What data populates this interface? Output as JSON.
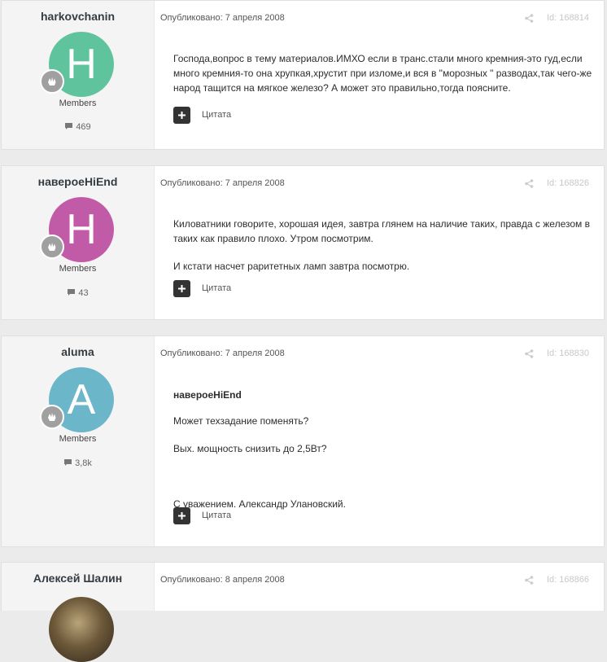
{
  "posts": [
    {
      "author": "harkovchanin",
      "avatar_letter": "H",
      "avatar_color": "#5fc49d",
      "group": "Members",
      "post_count": "469",
      "published": "Опубликовано: 7 апреля 2008",
      "post_id": "Id: 168814",
      "quote_author": "",
      "paragraphs": [
        "Господа,вопрос в тему материалов.ИМХО если в транс.стали много кремния-это гуд,если много кремния-то она хрупкая,хрустит при изломе,и вся в \"морозных \" разводах,так чего-же народ тащится на мягкое железо? А может это правильно,тогда поясните."
      ],
      "quote_label": "Цитата"
    },
    {
      "author": "навероеHiEnd",
      "avatar_letter": "H",
      "avatar_color": "#c15ba7",
      "group": "Members",
      "post_count": "43",
      "published": "Опубликовано: 7 апреля 2008",
      "post_id": "Id: 168826",
      "quote_author": "",
      "paragraphs": [
        "Киловатники говорите, хорошая идея, завтра глянем на наличие таких, правда с железом в таких как правило плохо. Утром посмотрим.",
        "И кстати насчет раритетных ламп завтра посмотрю."
      ],
      "quote_label": "Цитата"
    },
    {
      "author": "aluma",
      "avatar_letter": "A",
      "avatar_color": "#6bb7c9",
      "group": "Members",
      "post_count": "3,8k",
      "published": "Опубликовано: 7 апреля 2008",
      "post_id": "Id: 168830",
      "quote_author": "навероеHiEnd",
      "paragraphs": [
        "Может техзадание поменять?",
        "Вых. мощность снизить до 2,5Вт?",
        "",
        "С уважением. Александр Улановский."
      ],
      "quote_label": "Цитата"
    },
    {
      "author": "Алексей Шалин",
      "published": "Опубликовано: 8 апреля 2008",
      "post_id": "Id: 168866"
    }
  ],
  "icons": {
    "rank": "hand-rank-icon",
    "comment": "comment-icon",
    "share": "share-icon",
    "quote": "plus-icon"
  }
}
